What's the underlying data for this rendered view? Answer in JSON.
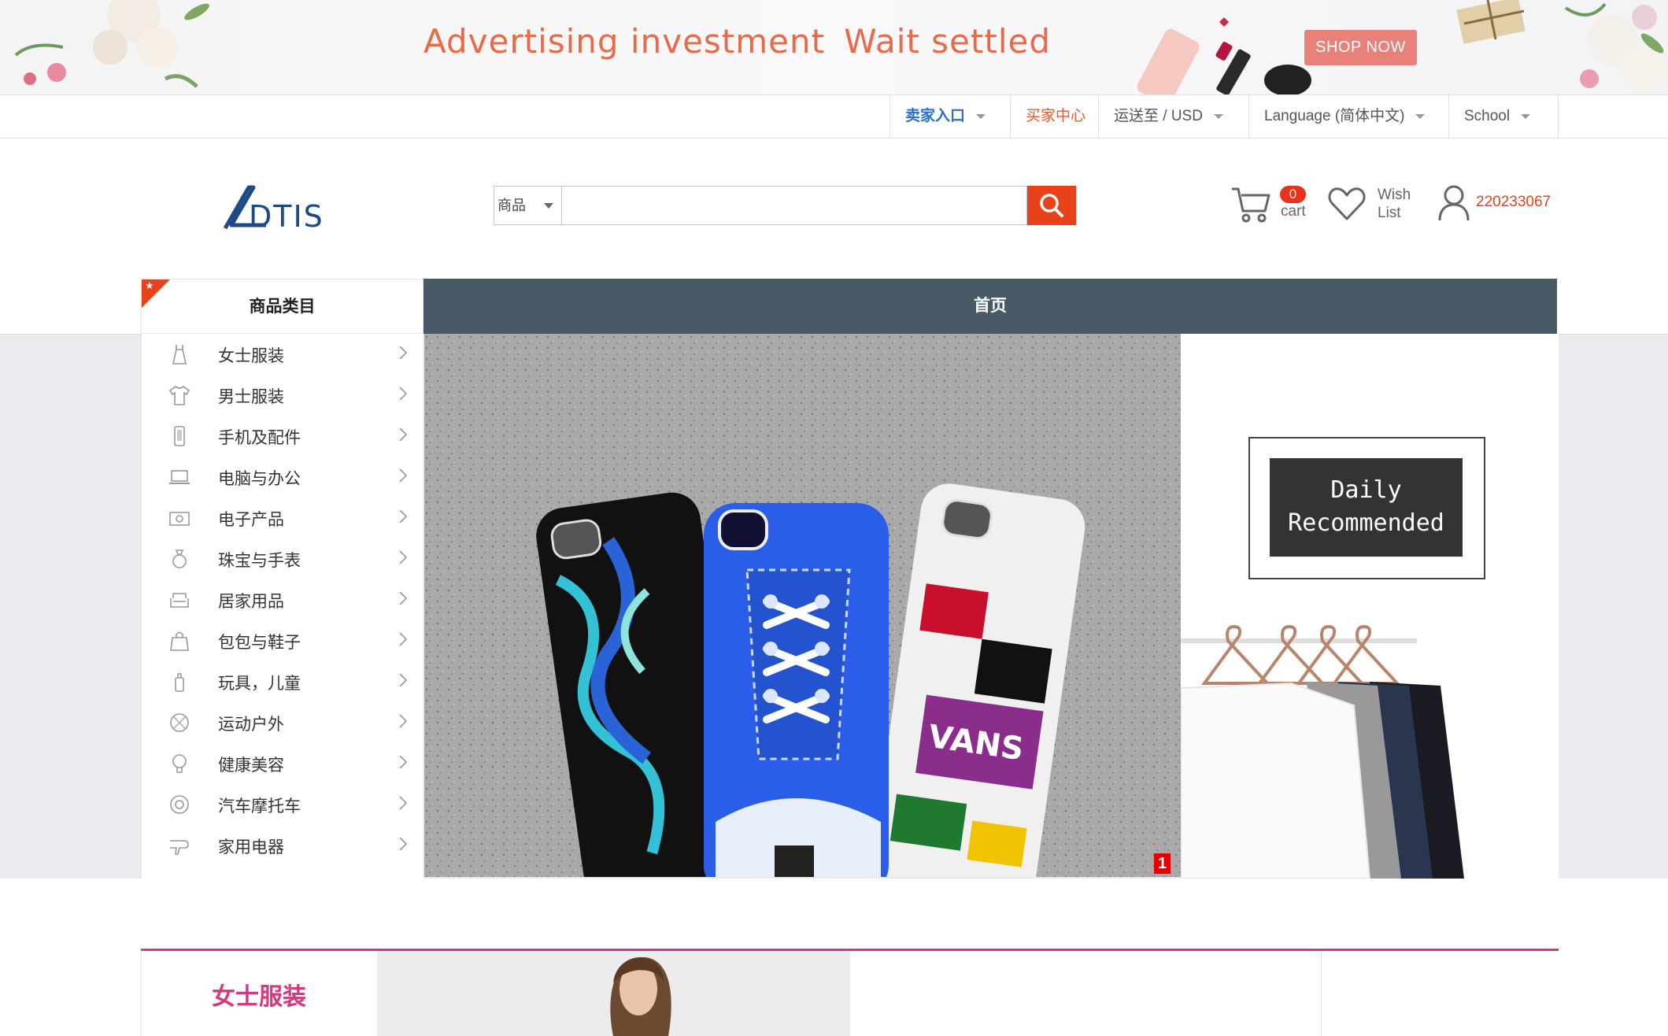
{
  "ad_banner": {
    "text_part1": "Advertising investment",
    "text_part2": "Wait settled",
    "shop_now": "SHOP NOW"
  },
  "topbar": {
    "seller_entry": "卖家入口",
    "buyer_center": "买家中心",
    "ship_to": "运送至 / USD",
    "language": "Language (简体中文)",
    "school": "School"
  },
  "header": {
    "search_category": "商品",
    "search_placeholder": "",
    "cart_count": "0",
    "cart_label": "cart",
    "wishlist_line1": "Wish",
    "wishlist_line2": "List",
    "user_id": "220233067"
  },
  "nav": {
    "category_title": "商品类目",
    "home": "首页"
  },
  "categories": [
    {
      "label": "女士服装",
      "icon": "dress-icon"
    },
    {
      "label": "男士服装",
      "icon": "tshirt-icon"
    },
    {
      "label": "手机及配件",
      "icon": "phone-icon"
    },
    {
      "label": "电脑与办公",
      "icon": "laptop-icon"
    },
    {
      "label": "电子产品",
      "icon": "camera-icon"
    },
    {
      "label": "珠宝与手表",
      "icon": "ring-icon"
    },
    {
      "label": "居家用品",
      "icon": "sofa-icon"
    },
    {
      "label": "包包与鞋子",
      "icon": "bag-icon"
    },
    {
      "label": "玩具，儿童",
      "icon": "baby-bottle-icon"
    },
    {
      "label": "运动户外",
      "icon": "ball-icon"
    },
    {
      "label": "健康美容",
      "icon": "lightbulb-icon"
    },
    {
      "label": "汽车摩托车",
      "icon": "wheel-icon"
    },
    {
      "label": "家用电器",
      "icon": "hairdryer-icon"
    }
  ],
  "hero": {
    "slide_indicator": "1"
  },
  "daily": {
    "line1": "Daily",
    "line2": "Recommended"
  },
  "floor": {
    "title": "女士服装"
  },
  "colors": {
    "accent_orange": "#e8421a",
    "nav_dark": "#475a66",
    "floor_pink": "#d6387f",
    "seller_blue": "#2a6fc9"
  }
}
